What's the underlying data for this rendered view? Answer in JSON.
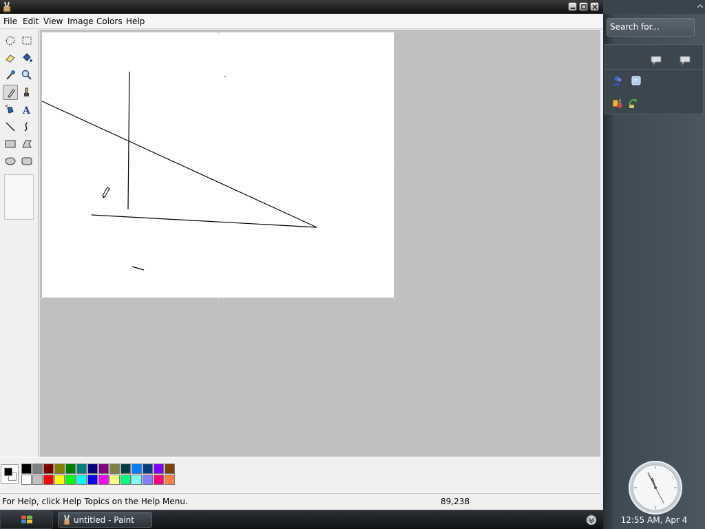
{
  "window": {
    "title_icon": "paint-app-icon",
    "controls": [
      "minimize-icon",
      "maximize-icon",
      "close-icon"
    ]
  },
  "menubar": {
    "file": "File",
    "edit": "Edit",
    "view": "View",
    "image": "Image",
    "colors": "Colors",
    "help": "Help"
  },
  "toolbox": {
    "tools": [
      "free-form-select-icon",
      "select-icon",
      "eraser-icon",
      "fill-icon",
      "pick-color-icon",
      "magnifier-icon",
      "pencil-icon",
      "brush-icon",
      "airbrush-icon",
      "text-icon",
      "line-icon",
      "curve-icon",
      "rectangle-icon",
      "polygon-icon",
      "ellipse-icon",
      "rounded-rectangle-icon"
    ],
    "active_tool": "pencil-icon"
  },
  "palette": {
    "foreground": "#000000",
    "background": "#ffffff",
    "top_row": [
      "#000000",
      "#808080",
      "#800000",
      "#808000",
      "#008000",
      "#008080",
      "#000080",
      "#800080",
      "#808040",
      "#004040",
      "#0080ff",
      "#004080",
      "#8000ff",
      "#804000"
    ],
    "bottom_row": [
      "#ffffff",
      "#c0c0c0",
      "#ff0000",
      "#ffff00",
      "#00ff00",
      "#00ffff",
      "#0000ff",
      "#ff00ff",
      "#ffff80",
      "#00ff80",
      "#80ffff",
      "#8080ff",
      "#ff0080",
      "#ff8040"
    ]
  },
  "statusbar": {
    "help_text": "For Help, click Help Topics on the Help Menu.",
    "coordinates": "89,238"
  },
  "sidebar": {
    "search_placeholder": "Search for...",
    "clock_caption": "12:55 AM, Apr 4"
  },
  "taskbar": {
    "task_label": "untitled - Paint"
  },
  "colors": {
    "workspace": "#c0c0c0",
    "canvas": "#ffffff",
    "sidebar": "#3f4a52"
  }
}
